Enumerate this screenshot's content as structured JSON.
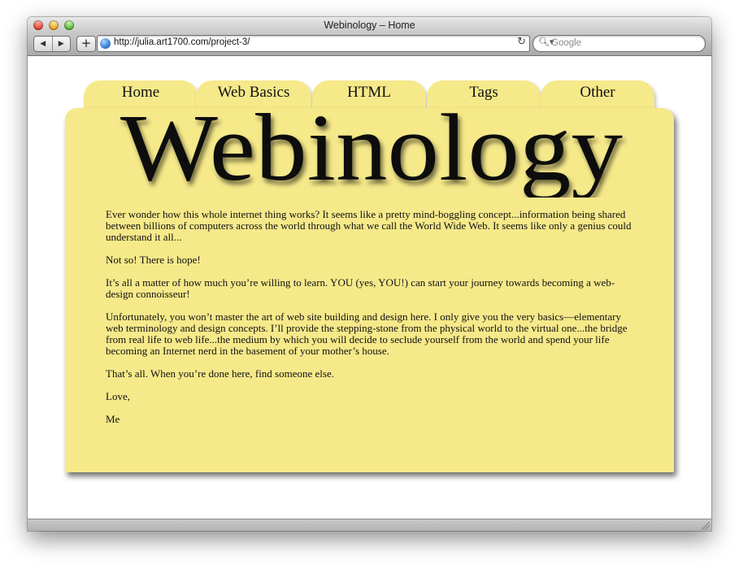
{
  "browser": {
    "title": "Webinology – Home",
    "url": "http://julia.art1700.com/project-3/",
    "search_placeholder": "Google",
    "icons": {
      "back": "back-arrow-icon",
      "forward": "forward-arrow-icon",
      "add": "plus-icon",
      "site": "globe-icon",
      "reload": "reload-icon",
      "search": "search-icon"
    }
  },
  "site": {
    "logo": "Webinology",
    "nav": [
      {
        "label": "Home"
      },
      {
        "label": "Web Basics"
      },
      {
        "label": "HTML"
      },
      {
        "label": "Tags"
      },
      {
        "label": "Other"
      }
    ],
    "paragraphs": [
      "Ever wonder how this whole internet thing works? It seems like a pretty mind-boggling concept...information being shared between billions of computers across the world through what we call the World Wide Web. It seems like only a genius could understand it all...",
      "Not so! There is hope!",
      "It’s all a matter of how much you’re willing to learn. YOU (yes, YOU!) can start your journey towards becoming a web-design connoisseur!",
      "Unfortunately, you won’t master the art of web site building and design here. I only give you the very basics—elementary web terminology and design concepts. I’ll provide the stepping-stone from the physical world to the virtual one...the bridge from real life to web life...the medium by which you will decide to seclude yourself from the world and spend your life becoming an Internet nerd in the basement of your mother’s house.",
      "That’s all. When you’re done here, find someone else.",
      "Love,",
      "Me"
    ],
    "colors": {
      "tab_bg": "#f6e98a",
      "panel_bg": "#f6e98a",
      "text": "#111111"
    }
  }
}
